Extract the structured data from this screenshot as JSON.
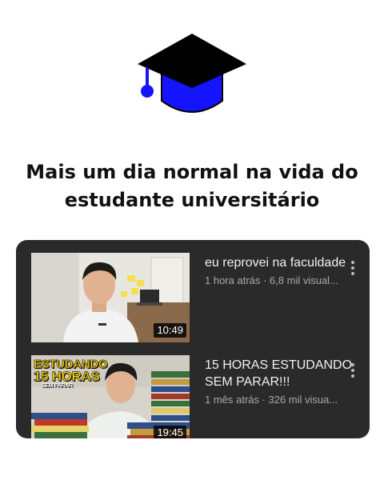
{
  "logo": {
    "icon": "graduation-cap-icon",
    "colors": {
      "cap_top": "#000000",
      "cap_base": "#1414ff",
      "tassel": "#1414ff"
    }
  },
  "headline": {
    "line1": "Mais um dia normal na vida do",
    "line2": "estudante universitário"
  },
  "videos": [
    {
      "title": "eu reprovei na faculdade",
      "meta": "1 hora atrás · 6,8 mil visual...",
      "duration": "10:49",
      "thumb_text": []
    },
    {
      "title": "15 HORAS ESTUDANDO SEM PARAR!!!",
      "meta": "1 mês atrás · 326 mil visua...",
      "duration": "19:45",
      "thumb_text": [
        "ESTUDANDO",
        "15 HORAS",
        "SEM PARAR"
      ]
    }
  ],
  "theme": {
    "panel_bg": "#2a2a2a",
    "title_color": "#f1f1f1",
    "meta_color": "#a9a9a9"
  }
}
